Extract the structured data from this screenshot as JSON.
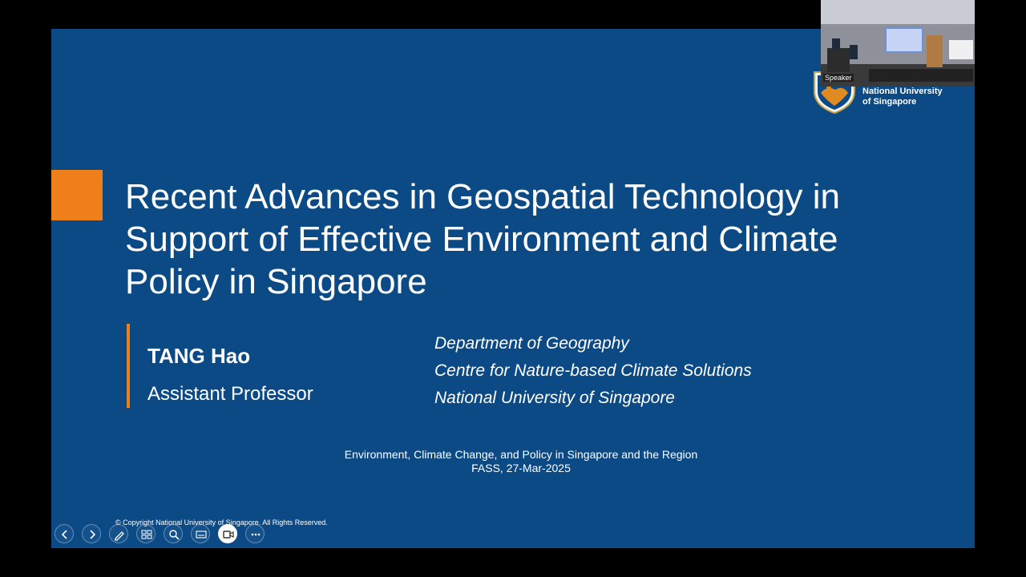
{
  "slide": {
    "title_lines": [
      "Recent Advances in Geospatial Technology in",
      "Support of Effective Environment and Climate",
      "Policy in Singapore"
    ],
    "presenter_name": "TANG Hao",
    "presenter_role": "Assistant Professor",
    "affiliation_lines": [
      "Department of Geography",
      "Centre for Nature-based Climate Solutions",
      "National University of Singapore"
    ],
    "event_line1": "Environment, Climate Change, and Policy in Singapore and the Region",
    "event_line2": "FASS, 27-Mar-2025",
    "copyright": "© Copyright National University of Singapore. All Rights Reserved.",
    "logo_text_line1": "National University",
    "logo_text_line2": "of Singapore"
  },
  "video_thumbnail": {
    "label": "Speaker"
  },
  "controls": [
    {
      "icon": "previous-slide-icon"
    },
    {
      "icon": "next-slide-icon"
    },
    {
      "icon": "pen-icon"
    },
    {
      "icon": "see-all-slides-icon"
    },
    {
      "icon": "zoom-icon"
    },
    {
      "icon": "subtitles-icon"
    },
    {
      "icon": "camera-icon"
    },
    {
      "icon": "more-options-icon"
    }
  ],
  "colors": {
    "slide_background": "#0c4a86",
    "accent": "#ee7f1a",
    "letterbox": "#000000"
  }
}
